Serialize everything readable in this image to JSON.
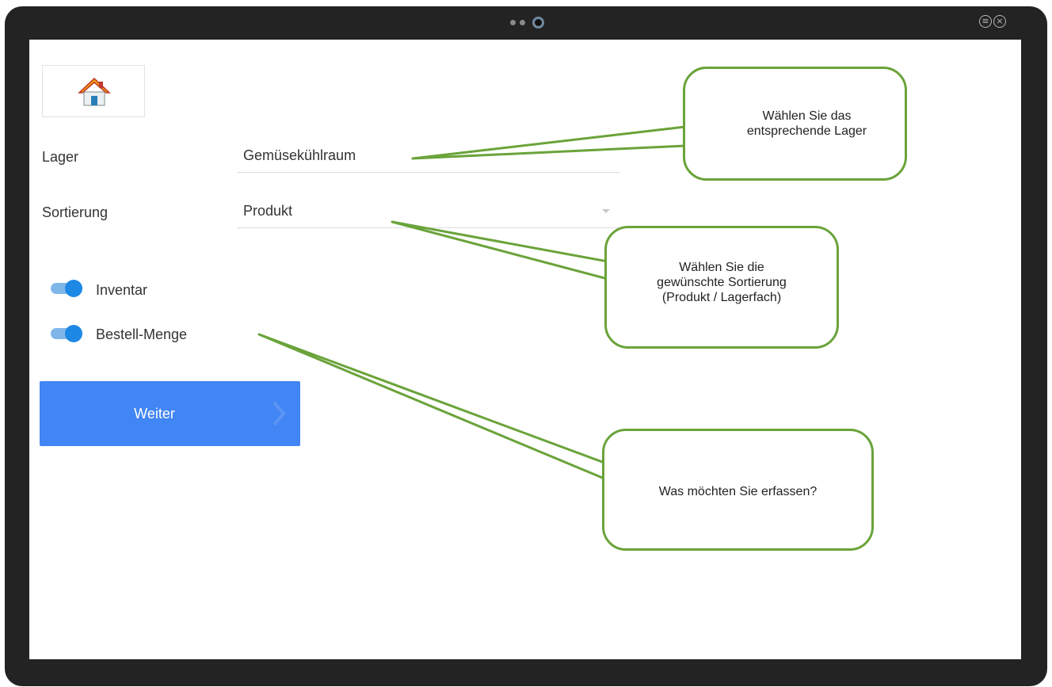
{
  "home": {
    "icon": "house-icon"
  },
  "form": {
    "lager_label": "Lager",
    "lager_value": "Gemüsekühlraum",
    "sortierung_label": "Sortierung",
    "sortierung_value": "Produkt"
  },
  "toggles": [
    {
      "label": "Inventar",
      "on": true
    },
    {
      "label": "Bestell-Menge",
      "on": true
    }
  ],
  "weiter_button": {
    "label": "Weiter",
    "icon": "chevron-right-icon"
  },
  "callouts": [
    {
      "text": "Wählen Sie das entsprechende Lager"
    },
    {
      "text": "Wählen Sie die gewünschte Sortierung (Produkt / Lagerfach)"
    },
    {
      "text": "Was möchten Sie erfassen?"
    }
  ],
  "colors": {
    "accent": "#4285f4",
    "toggle_on": "#1e88e5",
    "callout_border": "#6aa33a",
    "frame": "#232323"
  }
}
